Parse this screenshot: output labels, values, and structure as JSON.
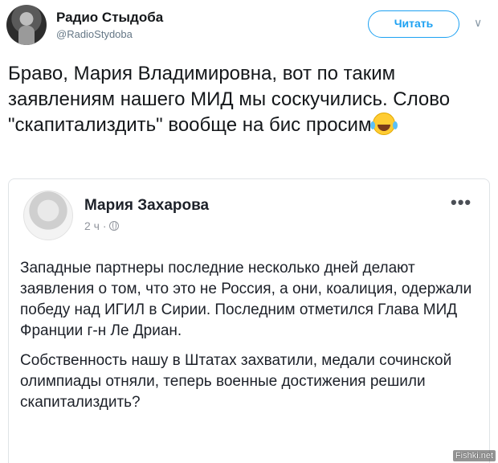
{
  "tweet": {
    "display_name": "Радио Стыдоба",
    "handle": "@RadioStydoba",
    "follow_label": "Читать",
    "chevron_icon": "chevron-down-icon",
    "text": "Браво, Мария Владимировна, вот по таким заявлениям нашего МИД мы соскучились. Слово \"скапитализдить\" вообще на бис просим",
    "emoji": "face-with-tears-of-joy"
  },
  "quoted_post": {
    "author": "Мария Захарова",
    "time": "2 ч ·",
    "privacy_icon": "globe-icon",
    "more_icon": "more-options-icon",
    "more_label": "•••",
    "paragraph_1": "Западные партнеры последние несколько дней делают заявления о том, что это не Россия, а они, коалиция, одержали победу над ИГИЛ в Сирии. Последним отметился Глава МИД Франции г-н Ле Дриан.",
    "paragraph_2": "Собственность нашу в Штатах захватили, медали сочинской олимпиады отняли, теперь военные достижения решили скапитализдить?"
  },
  "watermark": "Fishki.net",
  "colors": {
    "accent": "#1da1f2",
    "text": "#14171a",
    "muted": "#657786"
  }
}
